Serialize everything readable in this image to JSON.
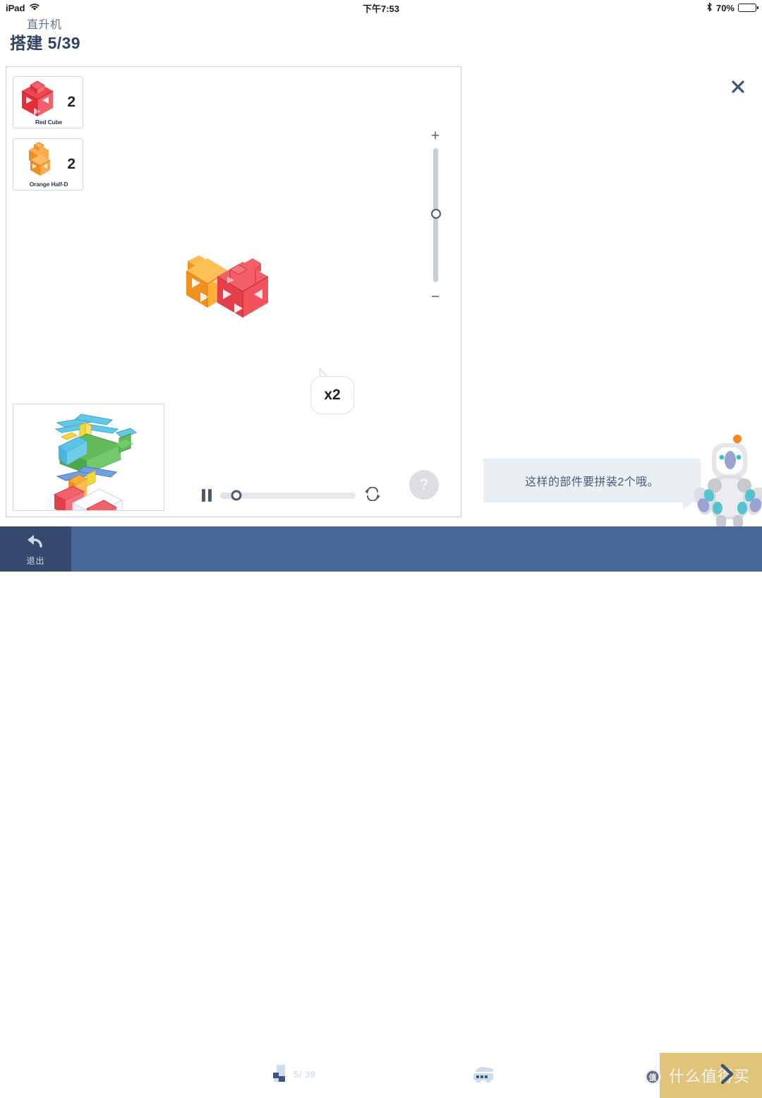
{
  "status_bar": {
    "device": "iPad",
    "wifi_icon": "wifi-icon",
    "time": "下午7:53",
    "bluetooth_icon": "bluetooth-icon",
    "battery_text": "70%",
    "battery_level_pct": 70
  },
  "header": {
    "model_name": "直升机",
    "build_label": "搭建",
    "step_text": "5/39"
  },
  "parts": [
    {
      "name": "Red Cube",
      "count": "2",
      "color": "#e8343e"
    },
    {
      "name": "Orange Half-D",
      "count": "2",
      "color": "#f0912c"
    }
  ],
  "zoom_slider": {
    "plus_label": "+",
    "minus_label": "−",
    "value_pct": 50
  },
  "callout": {
    "x2_label": "x2"
  },
  "playback": {
    "pause_icon": "pause-icon",
    "loop_icon": "loop-icon",
    "progress_pct": 12
  },
  "help": {
    "label": "?"
  },
  "close": {
    "icon": "close-icon"
  },
  "hint": {
    "message": "这样的部件要拼装2个哦。",
    "mascot": "robot-mascot"
  },
  "bottom_bar": {
    "exit_label": "退出",
    "exit_icon": "back-arrow-icon",
    "blocks_icon": "blocks-icon",
    "progress_count": "5/ 39",
    "progress_pct": 13,
    "device_icon": "device-icon",
    "next_icon": "chevron-right-icon"
  },
  "watermark": {
    "logo_char": "值",
    "text": "什么值得买"
  },
  "colors": {
    "bottom_bar": "#4a6897",
    "exit_panel": "#36496e",
    "gold": "#dfc479",
    "accent_blue": "#3d5573",
    "hint_bg": "#eaeff4"
  }
}
